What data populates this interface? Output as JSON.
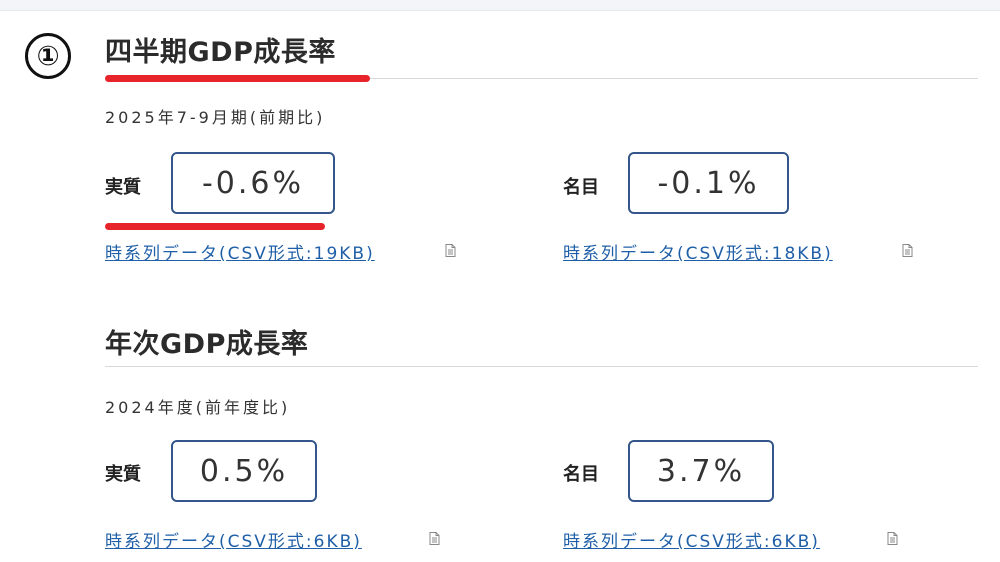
{
  "marker": "①",
  "quarterly": {
    "title": "四半期GDP成長率",
    "period": "2025年7-9月期(前期比)",
    "real_label": "実質",
    "real_value": "-0.6%",
    "nominal_label": "名目",
    "nominal_value": "-0.1%",
    "real_link": "時系列データ(CSV形式:19KB)",
    "nominal_link": "時系列データ(CSV形式:18KB)"
  },
  "annual": {
    "title": "年次GDP成長率",
    "period": "2024年度(前年度比)",
    "real_label": "実質",
    "real_value": "0.5%",
    "nominal_label": "名目",
    "nominal_value": "3.7%",
    "real_link": "時系列データ(CSV形式:6KB)",
    "nominal_link": "時系列データ(CSV形式:6KB)"
  },
  "icons": {
    "file": "document-icon"
  },
  "colors": {
    "accent_red": "#e8242b",
    "box_border": "#34568b",
    "link": "#1f5fa8"
  }
}
